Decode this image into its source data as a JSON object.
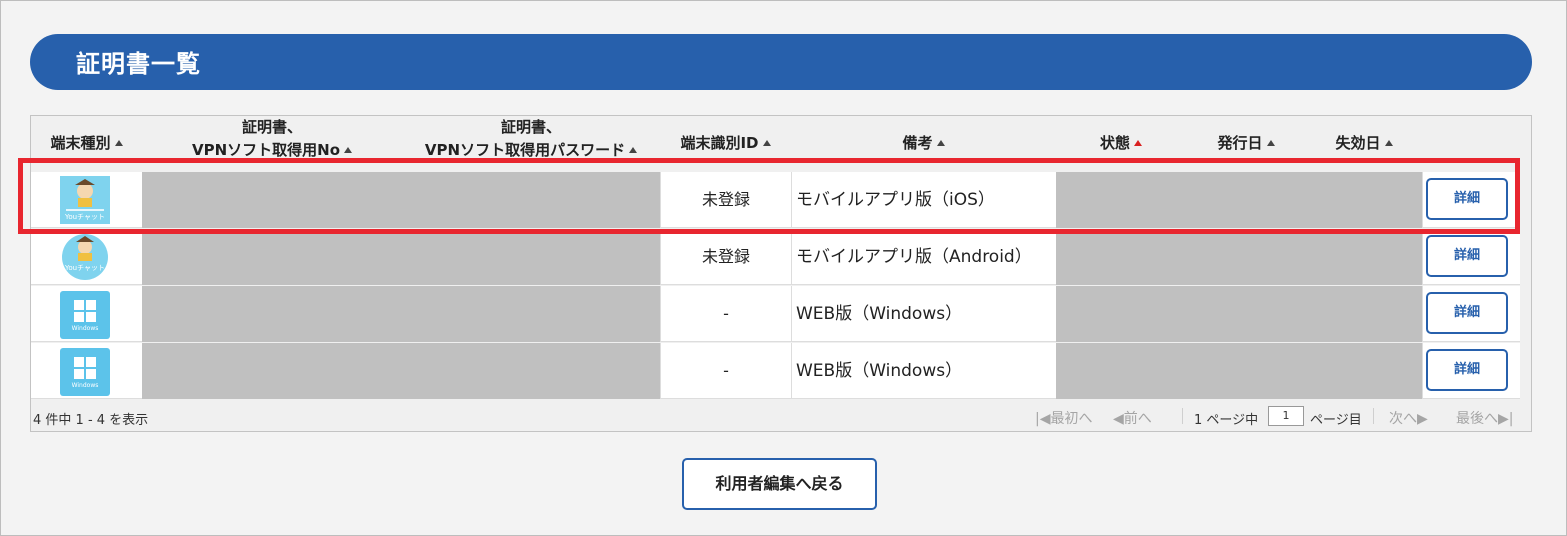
{
  "page": {
    "title": "証明書一覧"
  },
  "table": {
    "headers": {
      "device_type": "端末種別",
      "vpn_no_line1": "証明書、",
      "vpn_no_line2": "VPNソフト取得用No",
      "vpn_pw_line1": "証明書、",
      "vpn_pw_line2": "VPNソフト取得用パスワード",
      "device_id": "端末識別ID",
      "note": "備考",
      "status": "状態",
      "issued": "発行日",
      "expired": "失効日"
    },
    "sort_arrow_color": "#d92020",
    "rows": [
      {
        "icon": "youchat-app-icon",
        "device_id": "未登録",
        "note": "モバイルアプリ版（iOS）",
        "detail": "詳細"
      },
      {
        "icon": "youchat-app-icon",
        "device_id": "未登録",
        "note": "モバイルアプリ版（Android）",
        "detail": "詳細"
      },
      {
        "icon": "windows-icon",
        "device_id": "-",
        "note": "WEB版（Windows）",
        "detail": "詳細"
      },
      {
        "icon": "windows-icon",
        "device_id": "-",
        "note": "WEB版（Windows）",
        "detail": "詳細"
      }
    ],
    "icon_text": {
      "app": "Youチャット",
      "windows": "Windows"
    }
  },
  "pager": {
    "count": "4 件中 1 - 4 を表示",
    "first": "最初へ",
    "prev": "前へ",
    "page_prefix": "1 ページ中",
    "page_value": "1",
    "page_suffix": "ページ目",
    "next": "次へ",
    "last": "最後へ"
  },
  "actions": {
    "back": "利用者編集へ戻る"
  },
  "colors": {
    "brand": "#2760ac",
    "highlight": "#e8262f",
    "masked": "#c0c0c0"
  }
}
